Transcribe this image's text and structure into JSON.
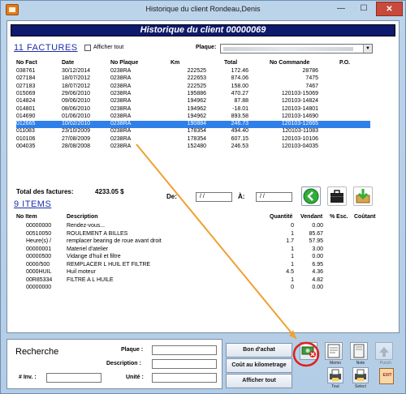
{
  "window": {
    "title": "Historique du client Rondeau,Denis",
    "min": "—",
    "max": "☐",
    "close": "✕"
  },
  "header": {
    "title": "Historique du client 00000069"
  },
  "factures": {
    "section_title": "11  FACTURES",
    "show_all_label": "Afficher tout",
    "plaque_label": "Plaque:",
    "columns": [
      "No Fact",
      "Date",
      "No Plaque",
      "Km",
      "Total",
      "No Commande",
      "P.O."
    ],
    "rows": [
      {
        "no": "038761",
        "date": "30/12/2014",
        "plaque": "0238RA",
        "km": "222525",
        "total": "172.46",
        "commande": "28786",
        "po": ""
      },
      {
        "no": "027184",
        "date": "18/07/2012",
        "plaque": "0238RA",
        "km": "222653",
        "total": "874.06",
        "commande": "7475",
        "po": ""
      },
      {
        "no": "027183",
        "date": "18/07/2012",
        "plaque": "0238RA",
        "km": "222525",
        "total": "158.00",
        "commande": "7467",
        "po": ""
      },
      {
        "no": "015069",
        "date": "29/06/2010",
        "plaque": "0238RA",
        "km": "195886",
        "total": "470.27",
        "commande": "120103-15069",
        "po": ""
      },
      {
        "no": "014824",
        "date": "09/06/2010",
        "plaque": "0238RA",
        "km": "194962",
        "total": "87.88",
        "commande": "120103-14824",
        "po": ""
      },
      {
        "no": "014801",
        "date": "08/06/2010",
        "plaque": "0238RA",
        "km": "194962",
        "total": "-18.01",
        "commande": "120103-14801",
        "po": ""
      },
      {
        "no": "014690",
        "date": "01/06/2010",
        "plaque": "0238RA",
        "km": "194962",
        "total": "893.58",
        "commande": "120103-14690",
        "po": ""
      },
      {
        "no": "012665",
        "date": "10/02/2010",
        "plaque": "0238RA",
        "km": "190884",
        "total": "246.73",
        "commande": "120103-12665",
        "po": ""
      },
      {
        "no": "011083",
        "date": "23/10/2009",
        "plaque": "0238RA",
        "km": "178354",
        "total": "494.40",
        "commande": "120103-11083",
        "po": ""
      },
      {
        "no": "010106",
        "date": "27/08/2009",
        "plaque": "0238RA",
        "km": "178354",
        "total": "607.15",
        "commande": "120103-10106",
        "po": ""
      },
      {
        "no": "004035",
        "date": "28/08/2008",
        "plaque": "0238RA",
        "km": "152480",
        "total": "246.53",
        "commande": "120103-04035",
        "po": ""
      }
    ],
    "selected_index": 7,
    "total_label": "Total des factures:",
    "total_value": "4233.05 $",
    "de_label": "De:",
    "a_label": "À:",
    "de_value": "/ /",
    "a_value": "/ /"
  },
  "items": {
    "section_title": "9  ITEMS",
    "columns": [
      "No Item",
      "Description",
      "Quantité",
      "Vendant",
      "% Esc.",
      "Coûtant"
    ],
    "rows": [
      {
        "no": "00000000",
        "desc": "Rendez-vous...",
        "qty": "0",
        "vendant": "0.00",
        "esc": "",
        "coutant": ""
      },
      {
        "no": "00510050",
        "desc": "ROULEMENT A BILLES",
        "qty": "1",
        "vendant": "85.67",
        "esc": "",
        "coutant": ""
      },
      {
        "no": "Heure(s) /",
        "desc": "remplacer bearing de roue avant droit",
        "qty": "1.7",
        "vendant": "57.95",
        "esc": "",
        "coutant": ""
      },
      {
        "no": "00000001",
        "desc": "Materiel d'atelier",
        "qty": "1",
        "vendant": "3.00",
        "esc": "",
        "coutant": ""
      },
      {
        "no": "00000500",
        "desc": "Vidange d'huil et filtre",
        "qty": "1",
        "vendant": "0.00",
        "esc": "",
        "coutant": ""
      },
      {
        "no": "0000/500",
        "desc": "REMPLACER L HUIL ET FILTRE",
        "qty": "1",
        "vendant": "6.95",
        "esc": "",
        "coutant": ""
      },
      {
        "no": "0000HUIL",
        "desc": "Huil moteur",
        "qty": "4.5",
        "vendant": "4.36",
        "esc": "",
        "coutant": ""
      },
      {
        "no": "00R85334",
        "desc": "FILTRE A L HUILE",
        "qty": "1",
        "vendant": "4.82",
        "esc": "",
        "coutant": ""
      },
      {
        "no": "00000000",
        "desc": "",
        "qty": "0",
        "vendant": "0.00",
        "esc": "",
        "coutant": ""
      }
    ]
  },
  "search": {
    "title": "Recherche",
    "plaque_label": "Plaque :",
    "description_label": "Description :",
    "unite_label": "Unité :",
    "inv_label": "# Inv. :"
  },
  "actions": {
    "bon_achat": "Bon d'achat",
    "cout_km": "Coût au kilometrage",
    "afficher_tout": "Afficher tout"
  },
  "tools": {
    "memo": "Memo",
    "note": "Note",
    "punch": "Punch",
    "tout": "Tout",
    "select": "Select",
    "exit": "EXIT"
  },
  "colors": {
    "header_bg": "#0e1a6e",
    "section_title": "#1c2fa8",
    "selection": "#2f7fe8",
    "annotation_arrow": "#f0a030",
    "annotation_circle": "#e0201a"
  },
  "icons": [
    "app-icon",
    "refresh-icon",
    "briefcase-icon",
    "download-icon",
    "money-cancel-icon",
    "memo-icon",
    "note-icon",
    "punch-icon",
    "printer-all-icon",
    "printer-select-icon",
    "exit-icon"
  ]
}
